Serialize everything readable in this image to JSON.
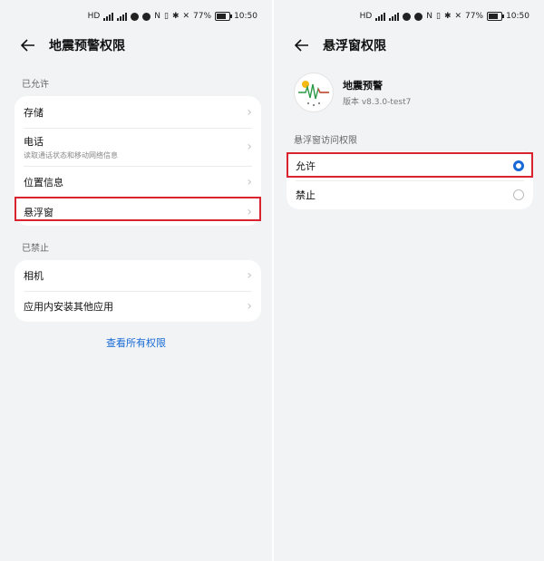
{
  "status_bar": {
    "battery": "77%",
    "time": "10:50"
  },
  "left": {
    "title": "地震预警权限",
    "allowed_label": "已允许",
    "allowed_items": [
      {
        "label": "存储",
        "sub": ""
      },
      {
        "label": "电话",
        "sub": "读取通话状态和移动网络信息"
      },
      {
        "label": "位置信息",
        "sub": ""
      },
      {
        "label": "悬浮窗",
        "sub": ""
      }
    ],
    "denied_label": "已禁止",
    "denied_items": [
      {
        "label": "相机"
      },
      {
        "label": "应用内安装其他应用"
      }
    ],
    "view_all": "查看所有权限"
  },
  "right": {
    "title": "悬浮窗权限",
    "app_name": "地震预警",
    "app_version": "版本 v8.3.0-test7",
    "section_label": "悬浮窗访问权限",
    "options": [
      {
        "label": "允许",
        "selected": true
      },
      {
        "label": "禁止",
        "selected": false
      }
    ]
  },
  "colors": {
    "highlight": "#d9232e",
    "accent": "#1769d6"
  }
}
